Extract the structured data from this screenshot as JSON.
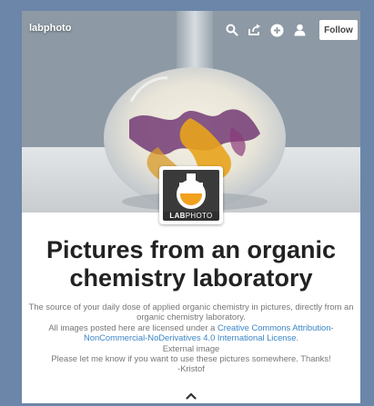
{
  "header": {
    "blog_name": "labphoto",
    "follow_label": "Follow",
    "icons": [
      "search-icon",
      "share-icon",
      "add-icon",
      "user-icon"
    ]
  },
  "avatar": {
    "text_lab": "LAB",
    "text_photo": "PHOTO"
  },
  "title": "Pictures from an organic chemistry laboratory",
  "description": {
    "line1": "The source of your daily dose of applied organic chemistry in pictures, directly from an organic chemistry laboratory.",
    "license_prefix": "All images posted here are licensed under a ",
    "license_link": "Creative Commons Attribution-NonCommercial-NoDerivatives 4.0 International License",
    "license_suffix": ".",
    "external_image": "External image",
    "contact": "Please let me know if you want to use these pictures somewhere. Thanks!",
    "signature": "-Kristof"
  },
  "colors": {
    "page_background": "#6b86a8",
    "link": "#3b85c4",
    "title": "#222222",
    "description": "#777777"
  }
}
